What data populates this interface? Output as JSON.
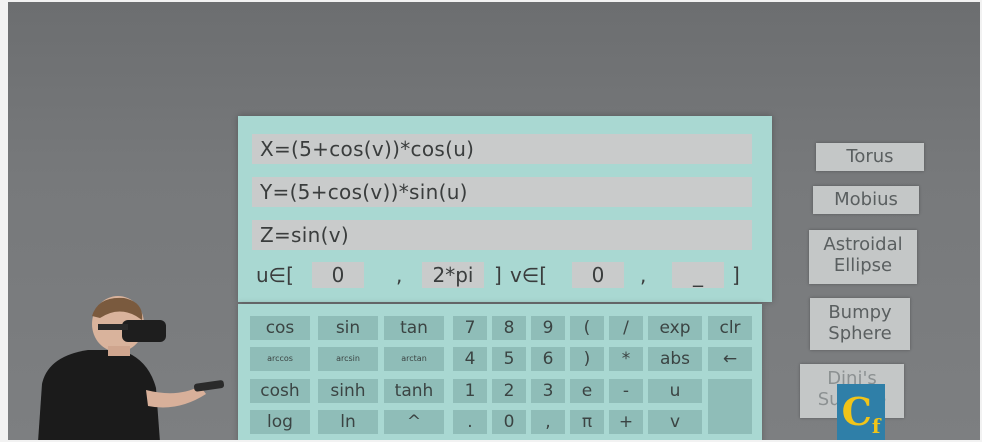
{
  "formulas": {
    "x": "X=(5+cos(v))*cos(u)",
    "y": "Y=(5+cos(v))*sin(u)",
    "z": "Z=sin(v)"
  },
  "range": {
    "u_label": "u∈[",
    "u_min": "0",
    "sep1": ",",
    "u_max": "2*pi",
    "u_close": "]",
    "v_label": "v∈[",
    "v_min": "0",
    "sep2": ",",
    "v_max": "_",
    "v_close": "]"
  },
  "keypad": {
    "rows": [
      [
        "cos",
        "sin",
        "tan",
        "7",
        "8",
        "9",
        "(",
        "/",
        "exp",
        "clr"
      ],
      [
        "arccos",
        "arcsin",
        "arctan",
        "4",
        "5",
        "6",
        ")",
        "*",
        "abs",
        "←"
      ],
      [
        "cosh",
        "sinh",
        "tanh",
        "1",
        "2",
        "3",
        "e",
        "-",
        "u",
        ""
      ],
      [
        "log",
        "ln",
        "^",
        ".",
        "0",
        ",",
        "π",
        "+",
        "v",
        ""
      ]
    ]
  },
  "presets": [
    "Torus",
    "Mobius",
    "Astroidal Ellipse",
    "Bumpy Sphere",
    "Dini's Surface"
  ],
  "logo": {
    "letter": "C",
    "sub": "f"
  }
}
